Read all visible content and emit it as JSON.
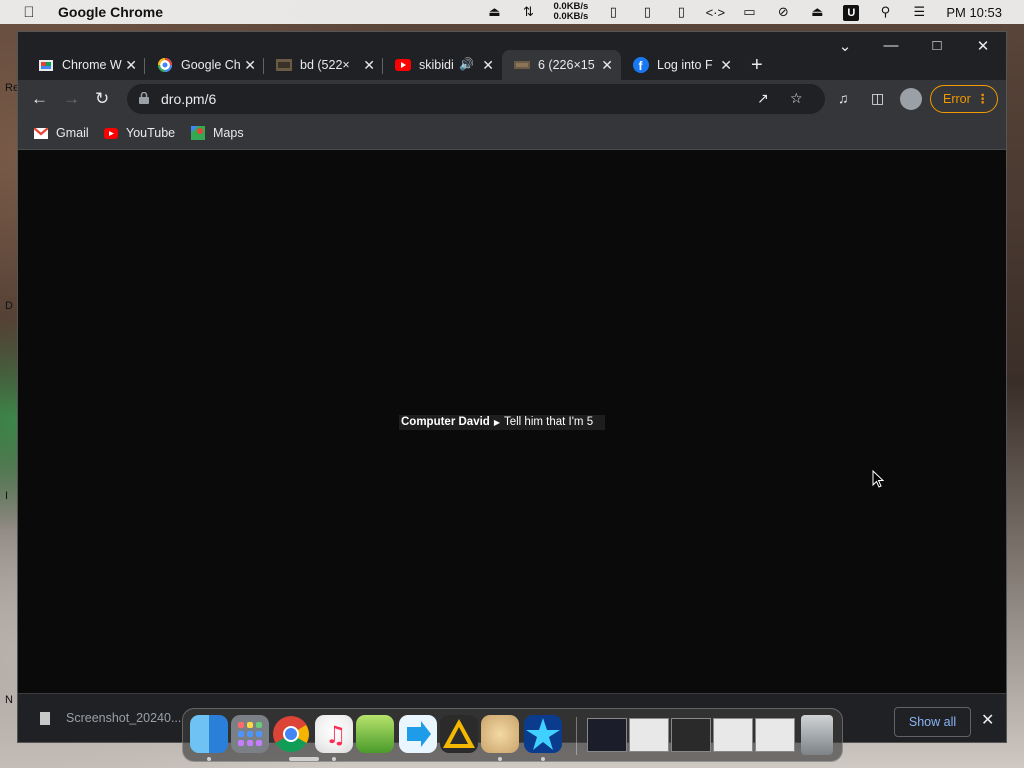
{
  "menubar": {
    "app_name": "Google Chrome",
    "net_up": "0.0KB/s",
    "net_down": "0.0KB/s",
    "u_badge": "U",
    "clock": "PM 10:53"
  },
  "desktop_labels": [
    "Re",
    "D",
    "I",
    "N"
  ],
  "tabs": [
    {
      "title": "Chrome W",
      "icon": "chrome-web-store-icon"
    },
    {
      "title": "Google Ch",
      "icon": "google-icon"
    },
    {
      "title": "bd (522×",
      "icon": "image-icon"
    },
    {
      "title": "skibidi",
      "icon": "youtube-icon"
    },
    {
      "title": "6 (226×15",
      "icon": "image-icon",
      "active": true
    },
    {
      "title": "Log into F",
      "icon": "facebook-icon"
    }
  ],
  "omnibox": {
    "url": "dro.pm/6"
  },
  "error_button": "Error",
  "bookmarks": [
    {
      "label": "Gmail",
      "icon": "gmail-icon"
    },
    {
      "label": "YouTube",
      "icon": "youtube-icon"
    },
    {
      "label": "Maps",
      "icon": "maps-icon"
    }
  ],
  "page": {
    "caption_name": "Computer David",
    "caption_text": "Tell him that I'm 5"
  },
  "downloads": {
    "file": "Screenshot_20240...",
    "show_all": "Show all"
  },
  "colors": {
    "accent_error": "#f29900",
    "tabstrip": "#202124",
    "toolbar": "#35363a",
    "link": "#8ab4f8"
  }
}
